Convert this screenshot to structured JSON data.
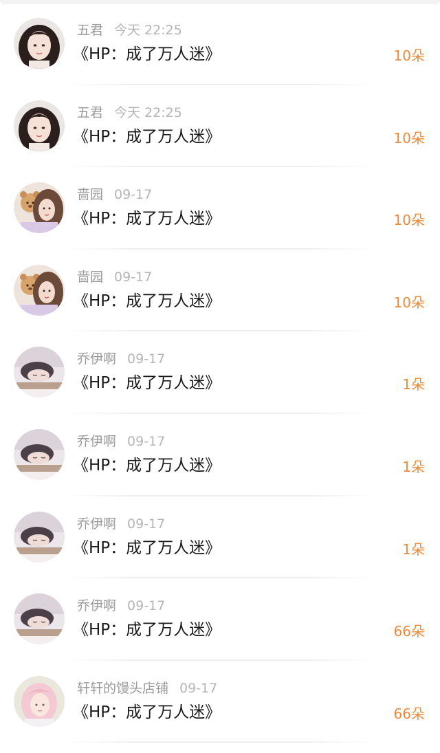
{
  "gifts": [
    {
      "user": "五君",
      "time": "今天 22:25",
      "book": "《HP：成了万人迷》",
      "amount": "10朵",
      "avatar": "girl-portrait-avatar"
    },
    {
      "user": "五君",
      "time": "今天 22:25",
      "book": "《HP：成了万人迷》",
      "amount": "10朵",
      "avatar": "girl-portrait-avatar"
    },
    {
      "user": "啬园",
      "time": "09-17",
      "book": "《HP：成了万人迷》",
      "amount": "10朵",
      "avatar": "girl-with-bear-avatar"
    },
    {
      "user": "啬园",
      "time": "09-17",
      "book": "《HP：成了万人迷》",
      "amount": "10朵",
      "avatar": "girl-with-bear-avatar"
    },
    {
      "user": "乔伊啊",
      "time": "09-17",
      "book": "《HP：成了万人迷》",
      "amount": "1朵",
      "avatar": "sleeping-girl-avatar"
    },
    {
      "user": "乔伊啊",
      "time": "09-17",
      "book": "《HP：成了万人迷》",
      "amount": "1朵",
      "avatar": "sleeping-girl-avatar"
    },
    {
      "user": "乔伊啊",
      "time": "09-17",
      "book": "《HP：成了万人迷》",
      "amount": "1朵",
      "avatar": "sleeping-girl-avatar"
    },
    {
      "user": "乔伊啊",
      "time": "09-17",
      "book": "《HP：成了万人迷》",
      "amount": "66朵",
      "avatar": "sleeping-girl-avatar"
    },
    {
      "user": "轩轩的馒头店铺",
      "time": "09-17",
      "book": "《HP：成了万人迷》",
      "amount": "66朵",
      "avatar": "pink-hair-avatar"
    }
  ],
  "colors": {
    "amount": "#ee8a3a",
    "title": "#1a1a1a",
    "meta": "#9a9a9a"
  }
}
